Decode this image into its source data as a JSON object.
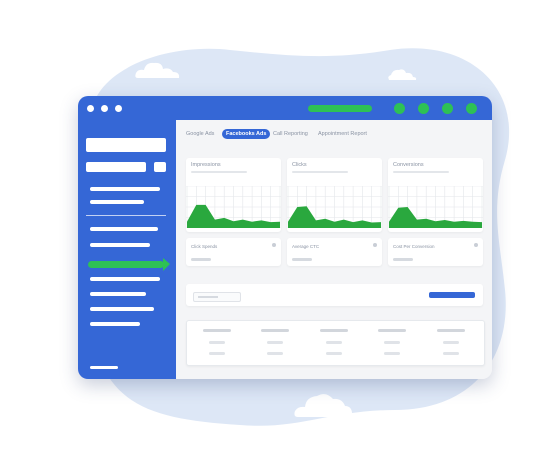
{
  "colors": {
    "accent": "#3567d6",
    "success": "#2ec155",
    "blob": "#dde7f6",
    "chart_fill": "#2aa83e",
    "chart_grid": "#e3e6ea"
  },
  "window": {
    "controls": [
      "window-dot",
      "window-dot",
      "window-dot"
    ],
    "toolbar_icons": [
      "status-dot",
      "status-dot",
      "status-dot",
      "status-dot"
    ]
  },
  "tabs": [
    {
      "label": "Google Ads",
      "active": false
    },
    {
      "label": "Facebooks Ads",
      "active": true
    },
    {
      "label": "Call Reporting",
      "active": false
    },
    {
      "label": "Appointment Report",
      "active": false
    }
  ],
  "metric_cards": [
    {
      "title": "Impressions",
      "chart": "area",
      "series": [
        0.15,
        0.55,
        0.55,
        0.2,
        0.24,
        0.16,
        0.2,
        0.15,
        0.18,
        0.14,
        0.15
      ]
    },
    {
      "title": "Clicks",
      "chart": "area",
      "series": [
        0.15,
        0.5,
        0.52,
        0.18,
        0.22,
        0.15,
        0.2,
        0.14,
        0.18,
        0.13,
        0.14
      ]
    },
    {
      "title": "Conversions",
      "chart": "area",
      "series": [
        0.15,
        0.48,
        0.5,
        0.2,
        0.22,
        0.16,
        0.19,
        0.15,
        0.17,
        0.15,
        0.14
      ]
    }
  ],
  "stat_cards": [
    {
      "label": "Click Spends"
    },
    {
      "label": "Average CTC"
    },
    {
      "label": "Cost Per Conversion"
    }
  ]
}
